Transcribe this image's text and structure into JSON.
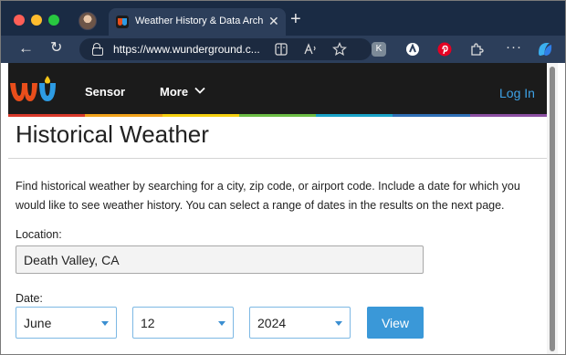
{
  "browser": {
    "tab_title": "Weather History & Data Archive",
    "tab_close": "✕",
    "new_tab": "+",
    "url": "https://www.wunderground.c...",
    "back_glyph": "←",
    "reload_glyph": "↻",
    "more_glyph": "···"
  },
  "site": {
    "nav": {
      "sensor": "Sensor",
      "more": "More",
      "login": "Log In"
    },
    "rainbow_colors": [
      "#d93a2b",
      "#f2a31b",
      "#f5d010",
      "#6cbd45",
      "#1aa3c8",
      "#2f6fb6",
      "#8c4fa2"
    ]
  },
  "page": {
    "title": "Historical Weather",
    "intro": "Find historical weather by searching for a city, zip code, or airport code. Include a date for which you would like to see weather history. You can select a range of dates in the results on the next page.",
    "location_label": "Location:",
    "location_value": "Death Valley, CA",
    "date_label": "Date:",
    "month": "June",
    "day": "12",
    "year": "2024",
    "view_button": "View"
  },
  "icons": [
    "back-icon",
    "reload-icon",
    "lock-icon",
    "reader-icon",
    "read-aloud-icon",
    "favorite-star-icon",
    "extension-icons",
    "more-menu-icon",
    "copilot-icon",
    "chevron-down-icon",
    "wu-logo"
  ]
}
